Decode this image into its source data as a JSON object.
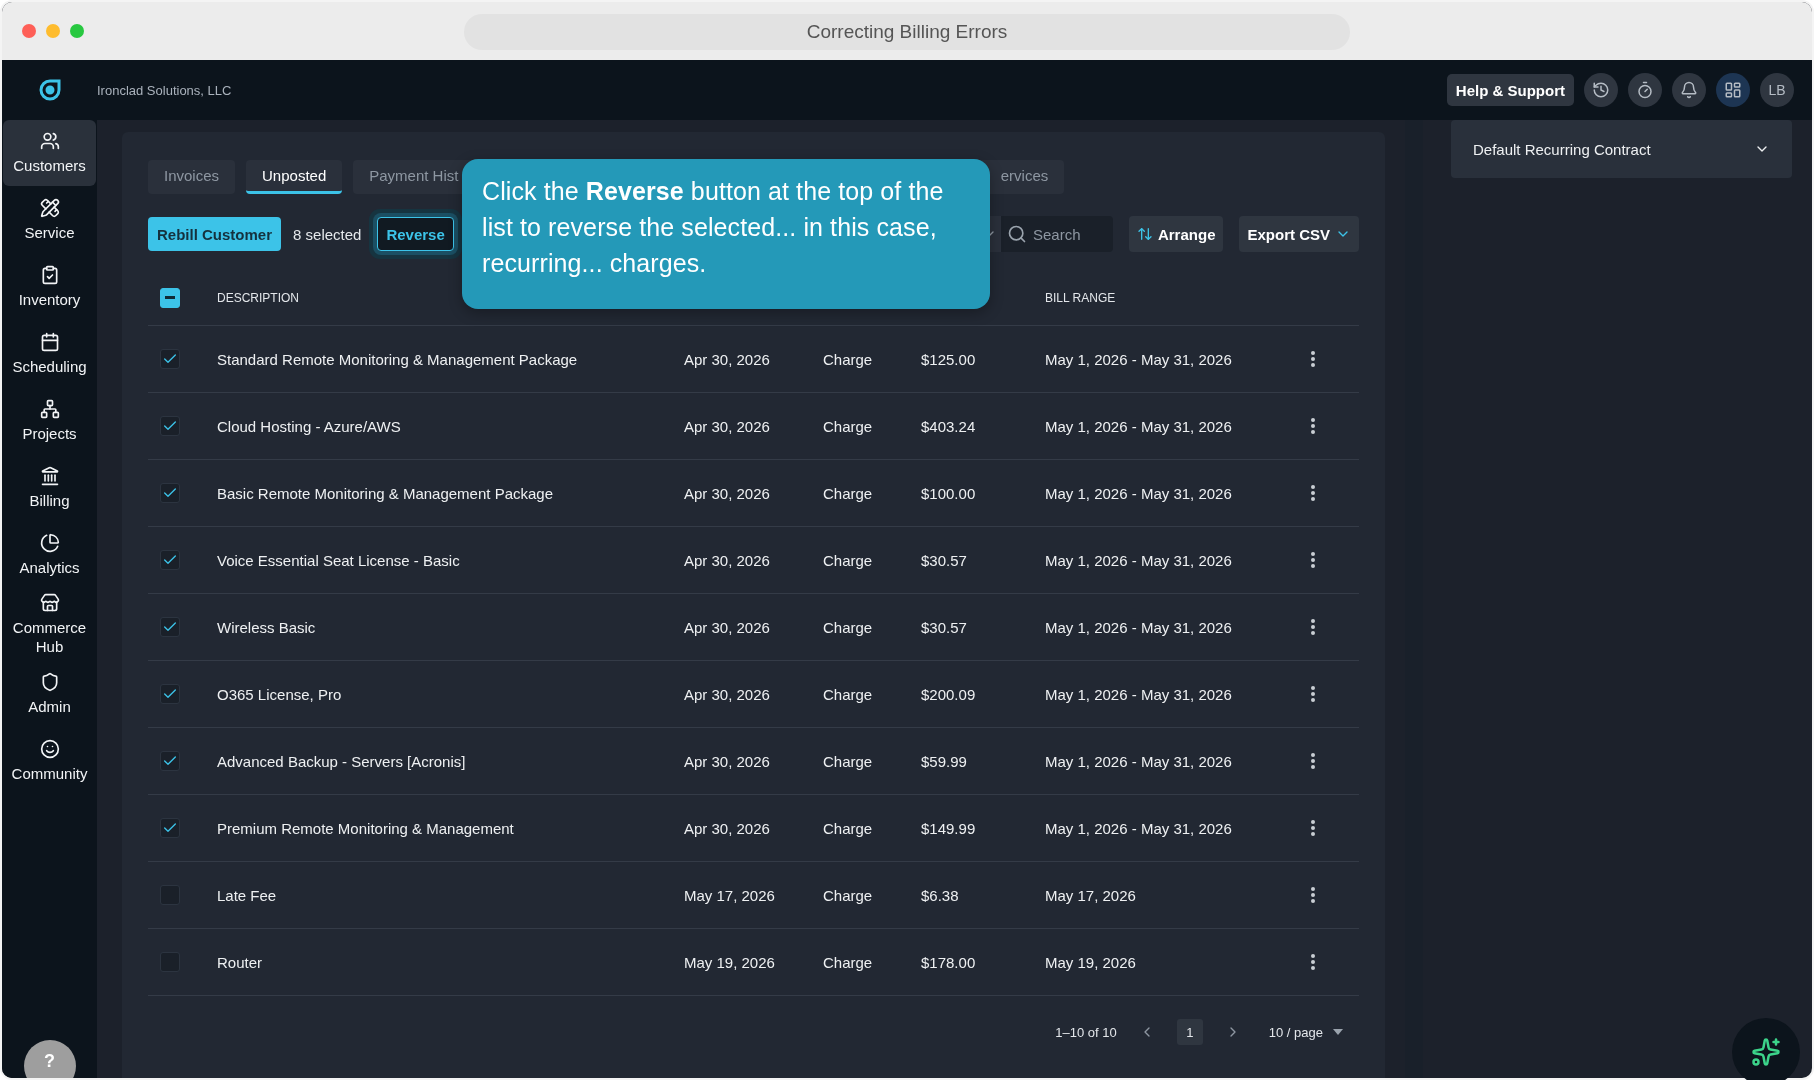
{
  "window": {
    "title": "Correcting Billing Errors"
  },
  "header": {
    "company": "Ironclad Solutions, LLC",
    "help_button": "Help & Support",
    "avatar": "LB"
  },
  "sidebar": {
    "items": [
      {
        "label": "Customers",
        "kind": "customers",
        "selected": true
      },
      {
        "label": "Service",
        "kind": "service",
        "selected": false
      },
      {
        "label": "Inventory",
        "kind": "inventory",
        "selected": false
      },
      {
        "label": "Scheduling",
        "kind": "scheduling",
        "selected": false
      },
      {
        "label": "Projects",
        "kind": "projects",
        "selected": false
      },
      {
        "label": "Billing",
        "kind": "billing",
        "selected": false
      },
      {
        "label": "Analytics",
        "kind": "analytics",
        "selected": false
      },
      {
        "label": "Commerce Hub",
        "kind": "commerce",
        "selected": false
      },
      {
        "label": "Admin",
        "kind": "admin",
        "selected": false
      },
      {
        "label": "Community",
        "kind": "community",
        "selected": false
      }
    ],
    "help": "?"
  },
  "tabs": [
    {
      "label": "Invoices",
      "selected": false
    },
    {
      "label": "Unposted",
      "selected": true
    },
    {
      "label": "Payment Hist",
      "selected": false
    },
    {
      "label": "ervices",
      "selected": false
    }
  ],
  "toolbar": {
    "rebill_button": "Rebill Customer",
    "selected_count": "8 selected",
    "reverse_button": {
      "label": "Reverse",
      "highlighted": true
    },
    "search": {
      "placeholder": "Search"
    },
    "arrange_button": "Arrange",
    "export_button": "Export CSV"
  },
  "tooltip": {
    "text": "Click the **Reverse** button at the top of the list to reverse the selected... in this case, recurring... charges."
  },
  "table": {
    "select_all": {
      "indeterminate": true
    },
    "description_header": "DESCRIPTION",
    "bill_range_header": "BILL RANGE",
    "rows": [
      {
        "checked": true,
        "description": "Standard Remote Monitoring & Management Package",
        "date": "Apr 30, 2026",
        "type": "Charge",
        "amount": "$125.00",
        "bill_range": "May 1, 2026 - May 31, 2026"
      },
      {
        "checked": true,
        "description": "Cloud Hosting - Azure/AWS",
        "date": "Apr 30, 2026",
        "type": "Charge",
        "amount": "$403.24",
        "bill_range": "May 1, 2026 - May 31, 2026"
      },
      {
        "checked": true,
        "description": "Basic Remote Monitoring & Management Package",
        "date": "Apr 30, 2026",
        "type": "Charge",
        "amount": "$100.00",
        "bill_range": "May 1, 2026 - May 31, 2026"
      },
      {
        "checked": true,
        "description": "Voice Essential Seat License - Basic",
        "date": "Apr 30, 2026",
        "type": "Charge",
        "amount": "$30.57",
        "bill_range": "May 1, 2026 - May 31, 2026"
      },
      {
        "checked": true,
        "description": "Wireless Basic",
        "date": "Apr 30, 2026",
        "type": "Charge",
        "amount": "$30.57",
        "bill_range": "May 1, 2026 - May 31, 2026"
      },
      {
        "checked": true,
        "description": "O365 License, Pro",
        "date": "Apr 30, 2026",
        "type": "Charge",
        "amount": "$200.09",
        "bill_range": "May 1, 2026 - May 31, 2026"
      },
      {
        "checked": true,
        "description": "Advanced Backup - Servers [Acronis]",
        "date": "Apr 30, 2026",
        "type": "Charge",
        "amount": "$59.99",
        "bill_range": "May 1, 2026 - May 31, 2026"
      },
      {
        "checked": true,
        "description": "Premium Remote Monitoring & Management",
        "date": "Apr 30, 2026",
        "type": "Charge",
        "amount": "$149.99",
        "bill_range": "May 1, 2026 - May 31, 2026"
      },
      {
        "checked": false,
        "description": "Late Fee",
        "date": "May 17, 2026",
        "type": "Charge",
        "amount": "$6.38",
        "bill_range": "May 17, 2026"
      },
      {
        "checked": false,
        "description": "Router",
        "date": "May 19, 2026",
        "type": "Charge",
        "amount": "$178.00",
        "bill_range": "May 19, 2026"
      }
    ]
  },
  "pagination": {
    "range": "1–10 of 10",
    "page": "1",
    "page_size": "10 / page"
  },
  "right_panel": {
    "contract": "Default Recurring Contract"
  }
}
